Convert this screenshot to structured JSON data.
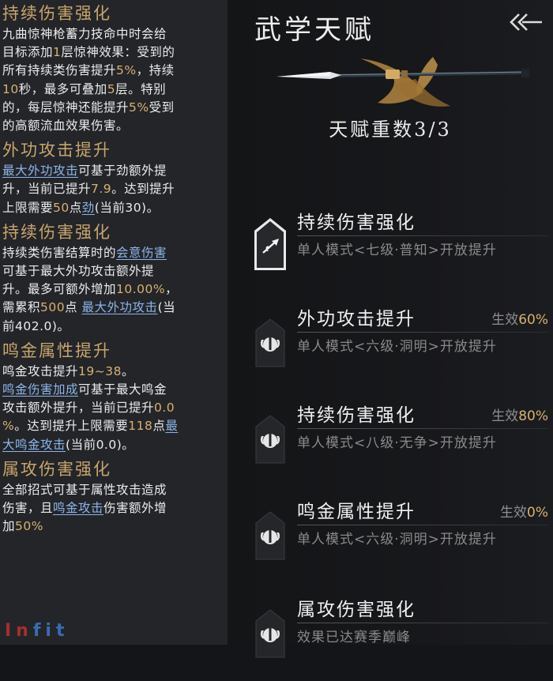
{
  "left_panel": {
    "sections": [
      {
        "title": "持续伤害强化",
        "lines": [
          [
            {
              "t": "九曲惊神枪蓄力技命中时会给"
            }
          ],
          [
            {
              "t": "目标添加"
            },
            {
              "t": "1",
              "c": "gold"
            },
            {
              "t": "层惊神效果：受到的"
            }
          ],
          [
            {
              "t": "所有持续类伤害提升"
            },
            {
              "t": "5%",
              "c": "gold"
            },
            {
              "t": "，持续"
            }
          ],
          [
            {
              "t": "10",
              "c": "gold"
            },
            {
              "t": "秒，最多可叠加"
            },
            {
              "t": "5",
              "c": "gold"
            },
            {
              "t": "层。特别"
            }
          ],
          [
            {
              "t": "的，每层惊神还能提升"
            },
            {
              "t": "5%",
              "c": "gold"
            },
            {
              "t": "受到"
            }
          ],
          [
            {
              "t": "的高额流血效果伤害。"
            }
          ]
        ]
      },
      {
        "title": "外功攻击提升",
        "lines": [
          [
            {
              "t": "最大外功攻击",
              "c": "lnk"
            },
            {
              "t": "可基于劲额外提"
            }
          ],
          [
            {
              "t": "升，当前已提升"
            },
            {
              "t": "7.9",
              "c": "gold"
            },
            {
              "t": "。达到提升"
            }
          ],
          [
            {
              "t": "上限需要"
            },
            {
              "t": "50",
              "c": "gold"
            },
            {
              "t": "点"
            },
            {
              "t": "劲",
              "c": "lnk"
            },
            {
              "t": "(当前30)。"
            }
          ]
        ]
      },
      {
        "title": "持续伤害强化",
        "lines": [
          [
            {
              "t": "持续类伤害结算时的"
            },
            {
              "t": "会意伤害",
              "c": "lnk"
            }
          ],
          [
            {
              "t": "可基于最大外功攻击额外提"
            }
          ],
          [
            {
              "t": "升。最多可额外增加"
            },
            {
              "t": "10.00%",
              "c": "gold"
            },
            {
              "t": "，"
            }
          ],
          [
            {
              "t": "需累积"
            },
            {
              "t": "500",
              "c": "gold"
            },
            {
              "t": "点 "
            },
            {
              "t": "最大外功攻击",
              "c": "lnk"
            },
            {
              "t": "(当"
            }
          ],
          [
            {
              "t": "前402.0)。"
            }
          ]
        ]
      },
      {
        "title": "鸣金属性提升",
        "lines": [
          [
            {
              "t": "鸣金攻击提升"
            },
            {
              "t": "19~38",
              "c": "gold"
            },
            {
              "t": "。"
            }
          ],
          [
            {
              "t": "鸣金伤害加成",
              "c": "lnk"
            },
            {
              "t": "可基于最大鸣金"
            }
          ],
          [
            {
              "t": "攻击额外提升，当前已提升"
            },
            {
              "t": "0.0",
              "c": "gold"
            }
          ],
          [
            {
              "t": "%",
              "c": "gold"
            },
            {
              "t": "。达到提升上限需要"
            },
            {
              "t": "118",
              "c": "gold"
            },
            {
              "t": "点"
            },
            {
              "t": "最",
              "c": "lnk"
            }
          ],
          [
            {
              "t": "大鸣金攻击",
              "c": "lnk"
            },
            {
              "t": "(当前0.0)。"
            }
          ]
        ]
      },
      {
        "title": "属攻伤害强化",
        "lines": [
          [
            {
              "t": "全部招式可基于属性攻击造成"
            }
          ],
          [
            {
              "t": "伤害，且"
            },
            {
              "t": "鸣金攻击",
              "c": "lnk"
            },
            {
              "t": "伤害额外增"
            }
          ],
          [
            {
              "t": "加"
            },
            {
              "t": "50%",
              "c": "gold"
            }
          ]
        ]
      }
    ],
    "watermark": {
      "left": "In",
      "right": "fit"
    }
  },
  "right_panel": {
    "title": "武学天赋",
    "back_icon": "double-chevron-left-icon",
    "talent_count_label": "天赋重数3/3",
    "items": [
      {
        "name": "持续伤害强化",
        "desc": "单人模式<七级·普知>开放提升",
        "effect_label": "",
        "effect_value": "",
        "node_type": "unlocked",
        "icon": "spear-icon"
      },
      {
        "name": "外功攻击提升",
        "desc": "单人模式<六级·洞明>开放提升",
        "effect_label": "生效",
        "effect_value": "60%",
        "node_type": "locked",
        "icon": "fist-emblem-icon"
      },
      {
        "name": "持续伤害强化",
        "desc": "单人模式<八级·无争>开放提升",
        "effect_label": "生效",
        "effect_value": "80%",
        "node_type": "locked",
        "icon": "fist-emblem-icon"
      },
      {
        "name": "鸣金属性提升",
        "desc": "单人模式<六级·洞明>开放提升",
        "effect_label": "生效",
        "effect_value": "0%",
        "node_type": "locked",
        "icon": "fist-emblem-icon"
      },
      {
        "name": "属攻伤害强化",
        "desc": "效果已达赛季巅峰",
        "effect_label": "",
        "effect_value": "",
        "node_type": "locked",
        "icon": "fist-emblem-icon"
      }
    ],
    "colors": {
      "accent_gold": "#d9b070",
      "link_blue": "#8db4ea",
      "title_gold": "#c9a56b"
    }
  }
}
